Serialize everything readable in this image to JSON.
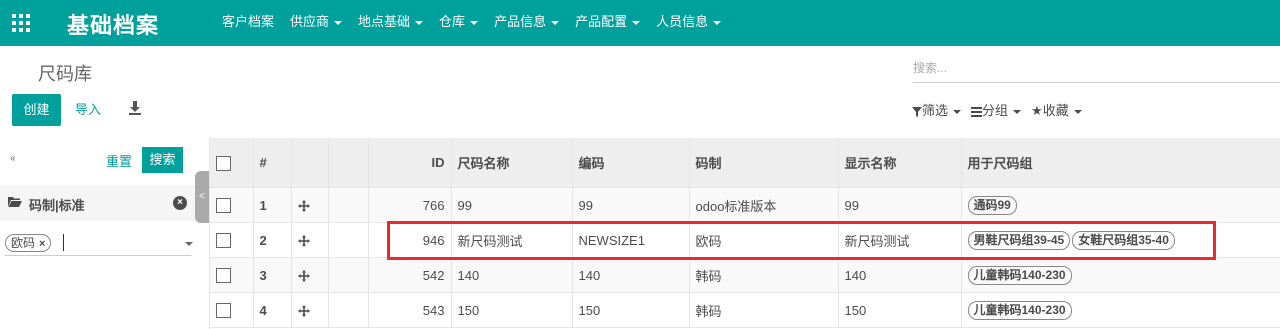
{
  "navbar": {
    "app_title": "基础档案",
    "menu": [
      {
        "label": "客户档案",
        "has_caret": false
      },
      {
        "label": "供应商",
        "has_caret": true
      },
      {
        "label": "地点基础",
        "has_caret": true
      },
      {
        "label": "仓库",
        "has_caret": true
      },
      {
        "label": "产品信息",
        "has_caret": true
      },
      {
        "label": "产品配置",
        "has_caret": true
      },
      {
        "label": "人员信息",
        "has_caret": true
      }
    ]
  },
  "control_panel": {
    "page_title": "尺码库",
    "search_placeholder": "搜索...",
    "create_label": "创建",
    "import_label": "导入",
    "filter_label": "筛选",
    "group_label": "分组",
    "favorite_label": "收藏"
  },
  "sidebar": {
    "reset_label": "重置",
    "search_label": "搜索",
    "section_label": "码制|标准",
    "tag_value": "欧码",
    "collapse_glyph": "«",
    "handle_glyph": "<"
  },
  "table": {
    "headers": {
      "row_no": "#",
      "id": "ID",
      "name": "尺码名称",
      "code": "编码",
      "system": "码制",
      "display_name": "显示名称",
      "groups": "用于尺码组"
    },
    "rows": [
      {
        "no": "1",
        "id": "766",
        "name": "99",
        "code": "99",
        "system": "odoo标准版本",
        "display_name": "99",
        "groups": [
          "通码99"
        ]
      },
      {
        "no": "2",
        "id": "946",
        "name": "新尺码测试",
        "code": "NEWSIZE1",
        "system": "欧码",
        "display_name": "新尺码测试",
        "groups": [
          "男鞋尺码组39-45",
          "女鞋尺码组35-40"
        ]
      },
      {
        "no": "3",
        "id": "542",
        "name": "140",
        "code": "140",
        "system": "韩码",
        "display_name": "140",
        "groups": [
          "儿童韩码140-230"
        ]
      },
      {
        "no": "4",
        "id": "543",
        "name": "150",
        "code": "150",
        "system": "韩码",
        "display_name": "150",
        "groups": [
          "儿童韩码140-230"
        ]
      }
    ]
  },
  "colors": {
    "brand": "#00a09d",
    "highlight": "#e8292f"
  }
}
